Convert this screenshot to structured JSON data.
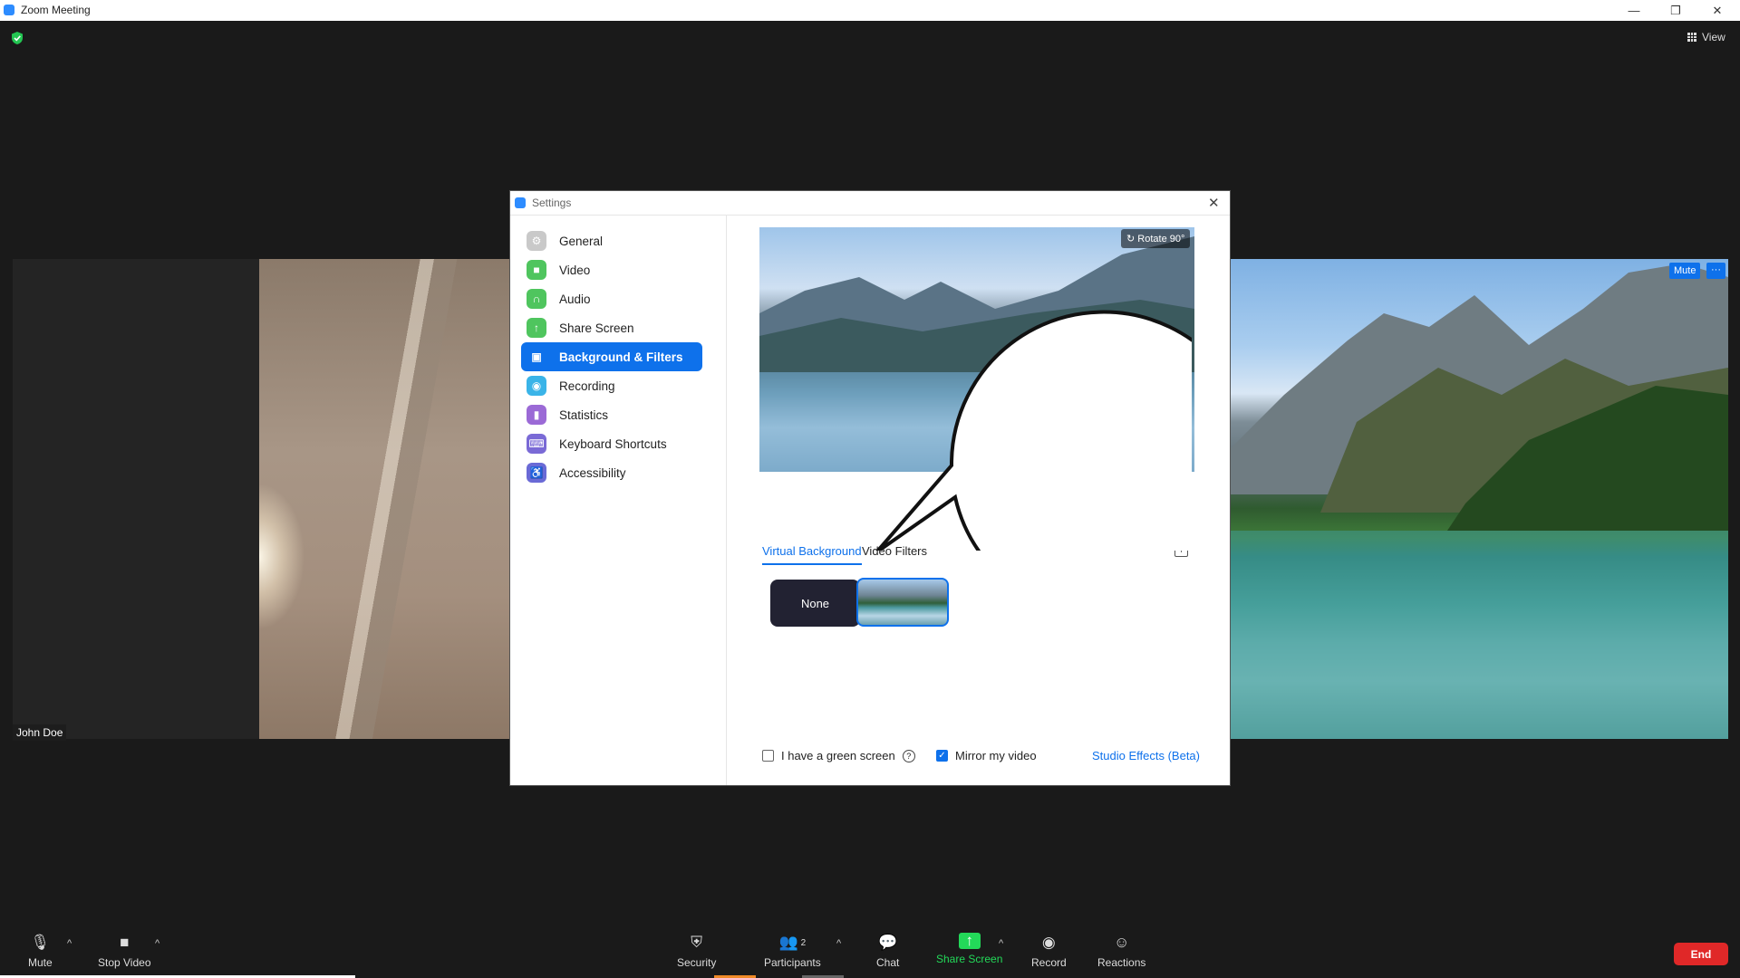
{
  "window": {
    "title": "Zoom Meeting",
    "minimize": "—",
    "maximize": "❐",
    "close": "✕"
  },
  "meeting": {
    "view_label": "View",
    "participant_name": "John Doe",
    "tile_mute_label": "Mute",
    "tile_more_label": "···"
  },
  "settings": {
    "title": "Settings",
    "close": "✕",
    "nav": [
      {
        "label": "General",
        "icon": "gear-icon",
        "color": "#c9c9c9"
      },
      {
        "label": "Video",
        "icon": "video-icon",
        "color": "#4fc55e"
      },
      {
        "label": "Audio",
        "icon": "headphones-icon",
        "color": "#4fc55e"
      },
      {
        "label": "Share Screen",
        "icon": "share-screen-icon",
        "color": "#4fc55e"
      },
      {
        "label": "Background & Filters",
        "icon": "background-icon",
        "color": "#0e71eb",
        "active": true
      },
      {
        "label": "Recording",
        "icon": "recording-icon",
        "color": "#3ab4e8"
      },
      {
        "label": "Statistics",
        "icon": "statistics-icon",
        "color": "#9b6ad6"
      },
      {
        "label": "Keyboard Shortcuts",
        "icon": "keyboard-icon",
        "color": "#7a6ad6"
      },
      {
        "label": "Accessibility",
        "icon": "accessibility-icon",
        "color": "#6a6ad6"
      }
    ],
    "rotate_label": "Rotate 90°",
    "tabs": {
      "virtual_background": "Virtual Background",
      "video_filters": "Video Filters"
    },
    "add_label": "+",
    "none_label": "None",
    "green_screen": {
      "label": "I have a green screen",
      "checked": false
    },
    "mirror": {
      "label": "Mirror my video",
      "checked": true
    },
    "studio_effects": "Studio Effects (Beta)"
  },
  "toolbar": {
    "mute": "Mute",
    "stop_video": "Stop Video",
    "security": "Security",
    "participants": "Participants",
    "participants_count": "2",
    "chat": "Chat",
    "share_screen": "Share Screen",
    "record": "Record",
    "reactions": "Reactions",
    "end": "End",
    "caret": "^"
  },
  "colors": {
    "accent": "#0e71eb",
    "end": "#e02828",
    "share": "#23d959"
  }
}
